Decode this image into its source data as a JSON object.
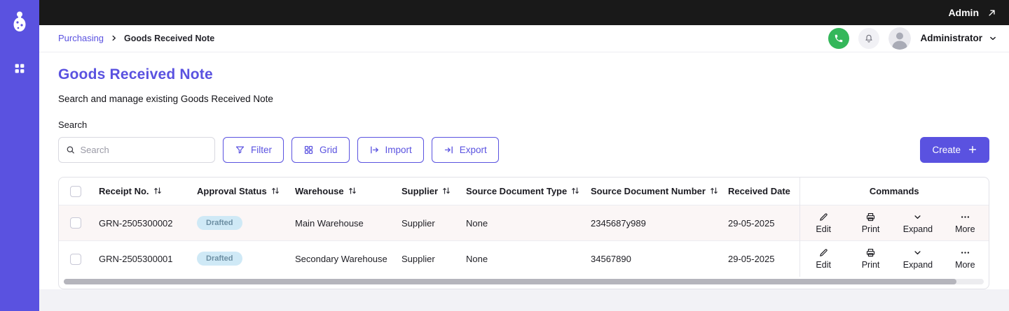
{
  "topbar": {
    "admin_label": "Admin"
  },
  "breadcrumb": {
    "parent": "Purchasing",
    "current": "Goods Received Note"
  },
  "user": {
    "name": "Administrator"
  },
  "page": {
    "title": "Goods Received Note",
    "subtitle": "Search and manage existing Goods Received Note",
    "search_section_label": "Search",
    "search_placeholder": "Search"
  },
  "toolbar": {
    "filter_label": "Filter",
    "grid_label": "Grid",
    "import_label": "Import",
    "export_label": "Export",
    "create_label": "Create"
  },
  "table": {
    "headers": [
      "Receipt No.",
      "Approval Status",
      "Warehouse",
      "Supplier",
      "Source Document Type",
      "Source Document Number",
      "Received Date",
      "Commands"
    ],
    "rows": [
      {
        "receipt_no": "GRN-2505300002",
        "approval_status": "Drafted",
        "warehouse": "Main Warehouse",
        "supplier": "Supplier",
        "source_document_type": "None",
        "source_document_number": "2345687y989",
        "received_date": "29-05-2025"
      },
      {
        "receipt_no": "GRN-2505300001",
        "approval_status": "Drafted",
        "warehouse": "Secondary Warehouse",
        "supplier": "Supplier",
        "source_document_type": "None",
        "source_document_number": "34567890",
        "received_date": "29-05-2025"
      }
    ],
    "commands": {
      "edit": "Edit",
      "print": "Print",
      "expand": "Expand",
      "more": "More"
    }
  },
  "colors": {
    "accent": "#5a52e0",
    "topbar_bg": "#191919",
    "badge_bg": "#cfe9f6",
    "badge_text": "#6d8fa3",
    "whatsapp_green": "#34b75a"
  }
}
